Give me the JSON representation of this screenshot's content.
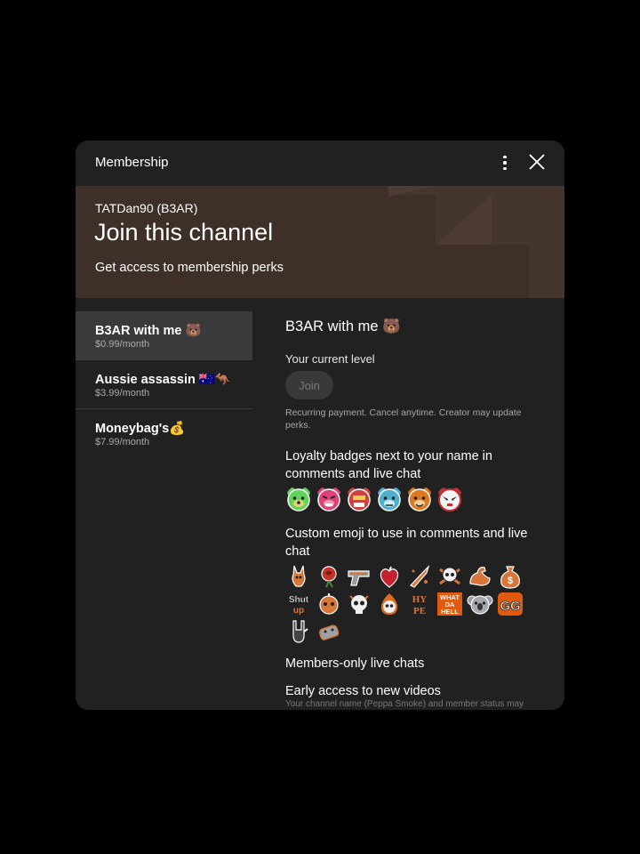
{
  "header": {
    "title": "Membership"
  },
  "banner": {
    "channel": "TATDan90 (B3AR)",
    "heading": "Join this channel",
    "subtitle": "Get access to membership perks"
  },
  "tiers": [
    {
      "name": "B3AR with me 🐻",
      "price": "$0.99/month"
    },
    {
      "name": "Aussie assassin 🇦🇺🦘",
      "price": "$3.99/month"
    },
    {
      "name": "Moneybag's💰",
      "price": "$7.99/month"
    }
  ],
  "detail": {
    "tier_name": "B3AR with me 🐻",
    "current_level": "Your current level",
    "join_label": "Join",
    "note": "Recurring payment. Cancel anytime. Creator may update perks.",
    "perk_badges": "Loyalty badges next to your name in comments and live chat",
    "perk_emoji": "Custom emoji to use in comments and live chat",
    "perk_chat": "Members-only live chats",
    "perk_early": "Early access to new videos",
    "footer_text": "Your channel name (Peppa Smoke) and member status may"
  },
  "badge_colors": [
    "#5fd35a",
    "#e0407a",
    "#d04040",
    "#4fb0d0",
    "#e07820",
    "#c03030"
  ],
  "emoji_texts": {
    "shut_up_1": "Shut",
    "shut_up_2": "up",
    "hype_1": "HY",
    "hype_2": "PE",
    "what_1": "WHAT",
    "what_2": "DA",
    "what_3": "HELL",
    "gg": "GG",
    "money": "$"
  }
}
